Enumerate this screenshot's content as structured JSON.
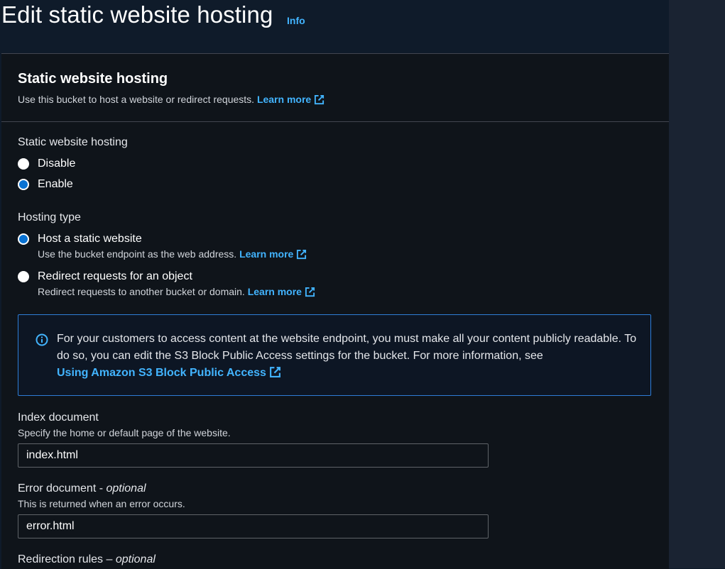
{
  "page": {
    "title": "Edit static website hosting",
    "info_label": "Info"
  },
  "panel": {
    "title": "Static website hosting",
    "description": "Use this bucket to host a website or redirect requests.",
    "learn_more": "Learn more"
  },
  "hosting": {
    "label": "Static website hosting",
    "options": [
      {
        "label": "Disable",
        "selected": false
      },
      {
        "label": "Enable",
        "selected": true
      }
    ]
  },
  "hosting_type": {
    "label": "Hosting type",
    "options": [
      {
        "label": "Host a static website",
        "description": "Use the bucket endpoint as the web address.",
        "learn_more": "Learn more",
        "selected": true
      },
      {
        "label": "Redirect requests for an object",
        "description": "Redirect requests to another bucket or domain.",
        "learn_more": "Learn more",
        "selected": false
      }
    ]
  },
  "alert": {
    "text": "For your customers to access content at the website endpoint, you must make all your content publicly readable. To do so, you can edit the S3 Block Public Access settings for the bucket. For more information, see",
    "link": "Using Amazon S3 Block Public Access"
  },
  "index_document": {
    "label": "Index document",
    "hint": "Specify the home or default page of the website.",
    "value": "index.html"
  },
  "error_document": {
    "label": "Error document - ",
    "optional": "optional",
    "hint": "This is returned when an error occurs.",
    "value": "error.html"
  },
  "redirection_rules": {
    "label": "Redirection rules – ",
    "optional": "optional"
  },
  "colors": {
    "link": "#42b4ff",
    "radio_selected": "#0972d3",
    "alert_border": "#2e7dd7",
    "panel_bg": "#0f141a"
  }
}
